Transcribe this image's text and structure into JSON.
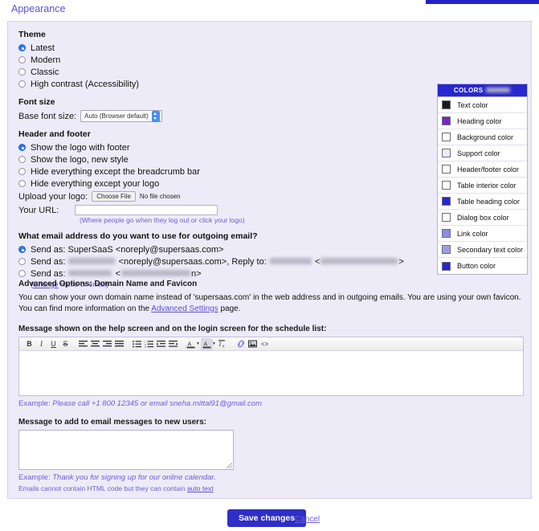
{
  "page_title": "Appearance",
  "theme": {
    "heading": "Theme",
    "options": [
      {
        "label": "Latest",
        "selected": true
      },
      {
        "label": "Modern",
        "selected": false
      },
      {
        "label": "Classic",
        "selected": false
      },
      {
        "label": "High contrast (Accessibility)",
        "selected": false
      }
    ]
  },
  "font_size": {
    "heading": "Font size",
    "label": "Base font size:",
    "value": "Auto (Browser default)",
    "options": [
      "Auto (Browser default)"
    ]
  },
  "header_footer": {
    "heading": "Header and footer",
    "options": [
      {
        "label": "Show the logo with footer",
        "selected": true
      },
      {
        "label": "Show the logo, new style",
        "selected": false
      },
      {
        "label": "Hide everything except the breadcrumb bar",
        "selected": false
      },
      {
        "label": "Hide everything except your logo",
        "selected": false
      }
    ],
    "upload_label": "Upload your logo:",
    "choose_file_label": "Choose File",
    "no_file_label": "No file chosen",
    "url_label": "Your URL:",
    "url_value": "",
    "url_hint": "(Where people go when they log out or click your logo)"
  },
  "email": {
    "heading": "What email address do you want to use for outgoing email?",
    "options": [
      {
        "prefix": "Send as: SuperSaaS <noreply@supersaas.com>",
        "selected": true,
        "redacted": false
      },
      {
        "prefix": "Send as:",
        "mid": "<noreply@supersaas.com>, Reply to:",
        "suffix": "<",
        "end": ">",
        "selected": false,
        "redacted": true
      },
      {
        "prefix": "Send as:",
        "mid": "<",
        "suffix": "n>",
        "selected": false,
        "redacted": true
      }
    ],
    "change_link": "Change",
    "change_suffix": " name or email)",
    "change_prefix": "("
  },
  "advanced": {
    "title": "Advanced Options: Domain Name and Favicon",
    "body_1": "You can show your own domain name instead of 'supersaas.com' in the web address and in outgoing emails. You are using your own favicon. You can find more information on the ",
    "link": "Advanced Settings",
    "body_2": " page."
  },
  "help_message": {
    "label": "Message shown on the help screen and on the login screen for the schedule list:",
    "value": "",
    "example_prefix": "Example: ",
    "example_text": "Please call +1 800 12345 or email sneha.mittal91@gmail.com"
  },
  "editor_toolbar": {
    "buttons": [
      {
        "name": "bold-icon",
        "glyph": "B"
      },
      {
        "name": "italic-icon",
        "glyph": "I"
      },
      {
        "name": "underline-icon",
        "glyph": "U"
      },
      {
        "name": "strikethrough-icon",
        "glyph": "S"
      },
      {
        "name": "align-left-icon",
        "glyph": "≡"
      },
      {
        "name": "align-center-icon",
        "glyph": "≡"
      },
      {
        "name": "align-right-icon",
        "glyph": "≡"
      },
      {
        "name": "align-justify-icon",
        "glyph": "≡"
      },
      {
        "name": "bullet-list-icon",
        "glyph": "≣"
      },
      {
        "name": "numbered-list-icon",
        "glyph": "≣"
      },
      {
        "name": "indent-icon",
        "glyph": "⇥"
      },
      {
        "name": "outdent-icon",
        "glyph": "⇤"
      },
      {
        "name": "text-color-icon",
        "glyph": "A"
      },
      {
        "name": "highlight-color-icon",
        "glyph": "A"
      },
      {
        "name": "clear-formatting-icon",
        "glyph": "Iₓ"
      },
      {
        "name": "link-icon",
        "glyph": "🔗"
      },
      {
        "name": "image-icon",
        "glyph": "▣"
      },
      {
        "name": "source-code-icon",
        "glyph": "<>"
      }
    ]
  },
  "new_user_message": {
    "label": "Message to add to email messages to new users:",
    "value": "",
    "example_prefix": "Example: ",
    "example_text": "Thank you for signing up for our online calendar.",
    "note_prefix": "Emails cannot contain HTML code but they can contain ",
    "note_link": "auto text"
  },
  "colors": {
    "header": "COLORS",
    "reset": "(RESET)",
    "items": [
      {
        "label": "Text color",
        "swatch": "#1a1a1a"
      },
      {
        "label": "Heading color",
        "swatch": "#7b24c4"
      },
      {
        "label": "Background color",
        "swatch": "#ffffff"
      },
      {
        "label": "Support color",
        "swatch": "#eeebf8"
      },
      {
        "label": "Header/footer color",
        "swatch": "#ffffff"
      },
      {
        "label": "Table interior color",
        "swatch": "#ffffff"
      },
      {
        "label": "Table heading color",
        "swatch": "#2727cf"
      },
      {
        "label": "Dialog box color",
        "swatch": "#ffffff"
      },
      {
        "label": "Link color",
        "swatch": "#8e8ae6"
      },
      {
        "label": "Secondary text color",
        "swatch": "#9f9ce0"
      },
      {
        "label": "Button color",
        "swatch": "#2727cf"
      }
    ]
  },
  "footer": {
    "save_label": "Save changes",
    "cancel_label": "Cancel"
  }
}
